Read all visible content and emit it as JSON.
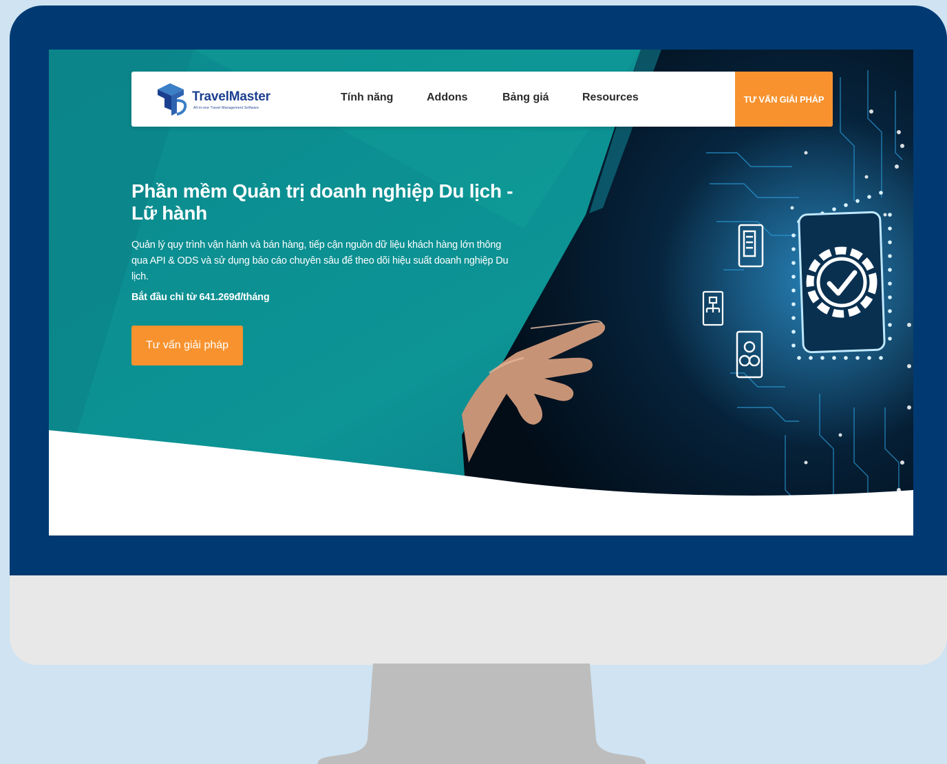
{
  "brand": {
    "name": "TravelMaster",
    "tagline": "All-in-one Travel Management Software"
  },
  "nav": {
    "items": [
      {
        "label": "Tính năng"
      },
      {
        "label": "Addons"
      },
      {
        "label": "Bảng giá"
      },
      {
        "label": "Resources"
      }
    ],
    "cta_label": "TƯ VẤN GIẢI PHÁP"
  },
  "hero": {
    "title": "Phần mềm Quản trị doanh nghiệp Du lịch - Lữ hành",
    "description": "Quản lý quy trình vận hành và bán hàng, tiếp cận nguồn dữ liệu khách hàng lớn thông qua API & ODS và sử dụng báo cáo chuyên sâu để theo dõi hiệu suất doanh nghiệp Du lịch.",
    "price": "Bắt đầu chỉ từ 641.269đ/tháng",
    "button_label": "Tư vấn giải pháp"
  },
  "colors": {
    "bezel": "#013a73",
    "accent": "#f7922e",
    "teal": "#0e8d8c",
    "brand_blue": "#1b3f8f",
    "background": "#cfe3f2"
  },
  "icons": [
    "travelmaster-logo-icon",
    "gear-check-icon",
    "document-icon",
    "sitemap-icon",
    "cluster-icon"
  ]
}
